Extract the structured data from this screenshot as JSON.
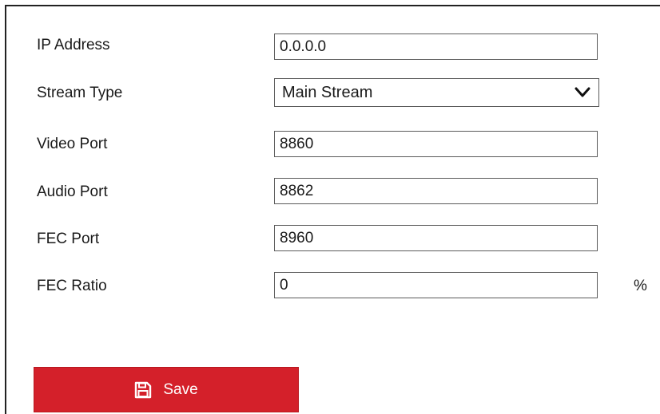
{
  "form": {
    "fields": [
      {
        "label": "IP Address",
        "value": "0.0.0.0",
        "type": "text"
      },
      {
        "label": "Stream Type",
        "value": "Main Stream",
        "type": "select"
      },
      {
        "label": "Video Port",
        "value": "8860",
        "type": "text"
      },
      {
        "label": "Audio Port",
        "value": "8862",
        "type": "text"
      },
      {
        "label": "FEC Port",
        "value": "8960",
        "type": "text"
      },
      {
        "label": "FEC Ratio",
        "value": "0",
        "type": "text",
        "unit": "%"
      }
    ],
    "save_label": "Save",
    "save_icon": "floppy-disk-icon",
    "accent_color": "#d4202a"
  }
}
